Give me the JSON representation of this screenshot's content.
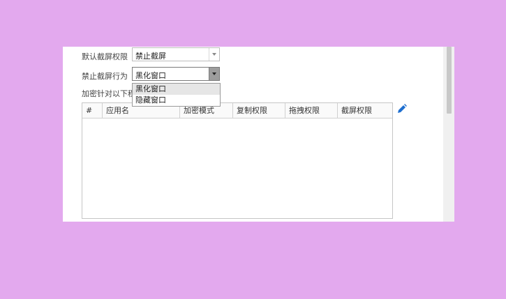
{
  "settings": {
    "default_label": "默认截屏权限",
    "default_value": "禁止截屏",
    "behavior_label": "禁止截屏行为",
    "behavior_value": "黑化窗口",
    "encrypt_label": "加密针对以下程"
  },
  "dropdown": {
    "options": [
      "黑化窗口",
      "隐藏窗口"
    ],
    "highlighted_index": 0
  },
  "table": {
    "columns": [
      "#",
      "应用名",
      "加密模式",
      "复制权限",
      "拖拽权限",
      "截屏权限"
    ],
    "rows": []
  },
  "icons": {
    "edit": "pencil-icon"
  },
  "colors": {
    "background": "#e3a9ee",
    "edit_icon": "#1e6fd0"
  }
}
